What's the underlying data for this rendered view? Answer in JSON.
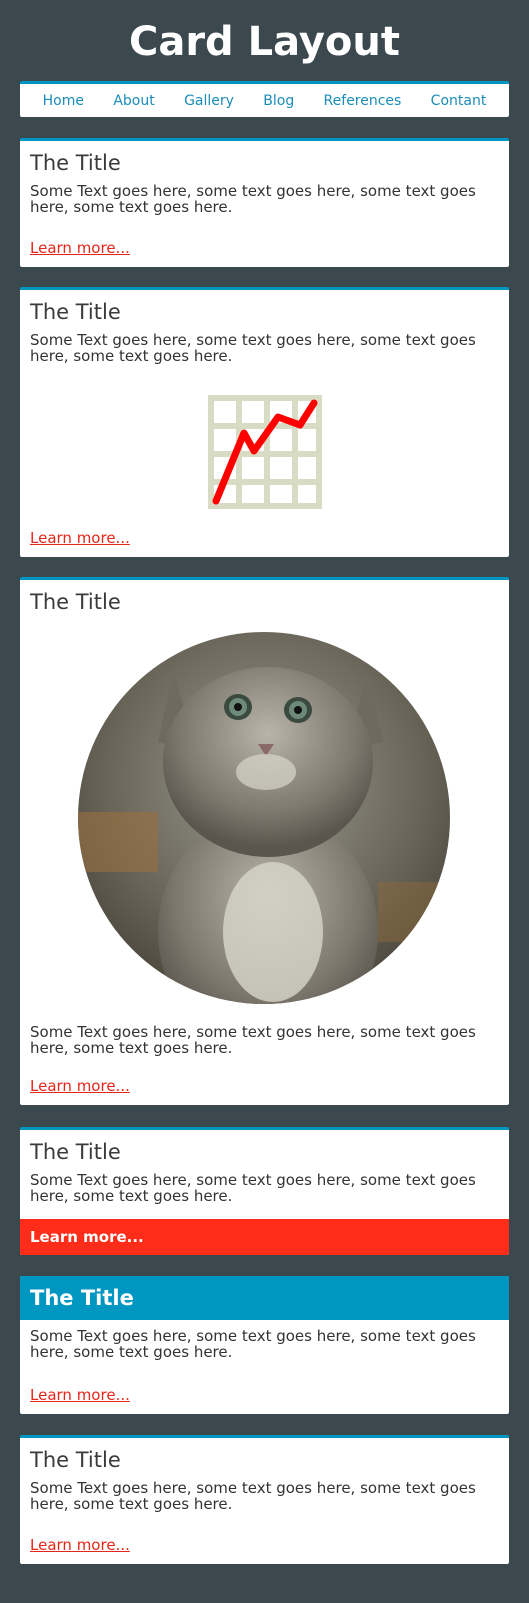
{
  "header": {
    "title": "Card Layout"
  },
  "nav": [
    "Home",
    "About",
    "Gallery",
    "Blog",
    "References",
    "Contant"
  ],
  "cards": [
    {
      "title": "The Title",
      "text": "Some Text goes here, some text goes here, some text goes here, some text goes here.",
      "link": "Learn more..."
    },
    {
      "title": "The Title",
      "text": "Some Text goes here, some text goes here, some text goes here, some text goes here.",
      "link": "Learn more..."
    },
    {
      "title": "The Title",
      "text": "Some Text goes here, some text goes here, some text goes here, some text goes here.",
      "link": "Learn more..."
    },
    {
      "title": "The Title",
      "text": "Some Text goes here, some text goes here, some text goes here, some text goes here.",
      "link": "Learn more..."
    },
    {
      "title": "The Title",
      "text": "Some Text goes here, some text goes here, some text goes here, some text goes here.",
      "link": "Learn more..."
    },
    {
      "title": "The Title",
      "text": "Some Text goes here, some text goes here, some text goes here, some text goes here.",
      "link": "Learn more..."
    }
  ],
  "colors": {
    "background": "#3b484e",
    "accent": "#0096c2",
    "link": "#e6261a",
    "cta": "#ff2c1a"
  },
  "icons": {
    "chart": "line-chart-icon"
  }
}
